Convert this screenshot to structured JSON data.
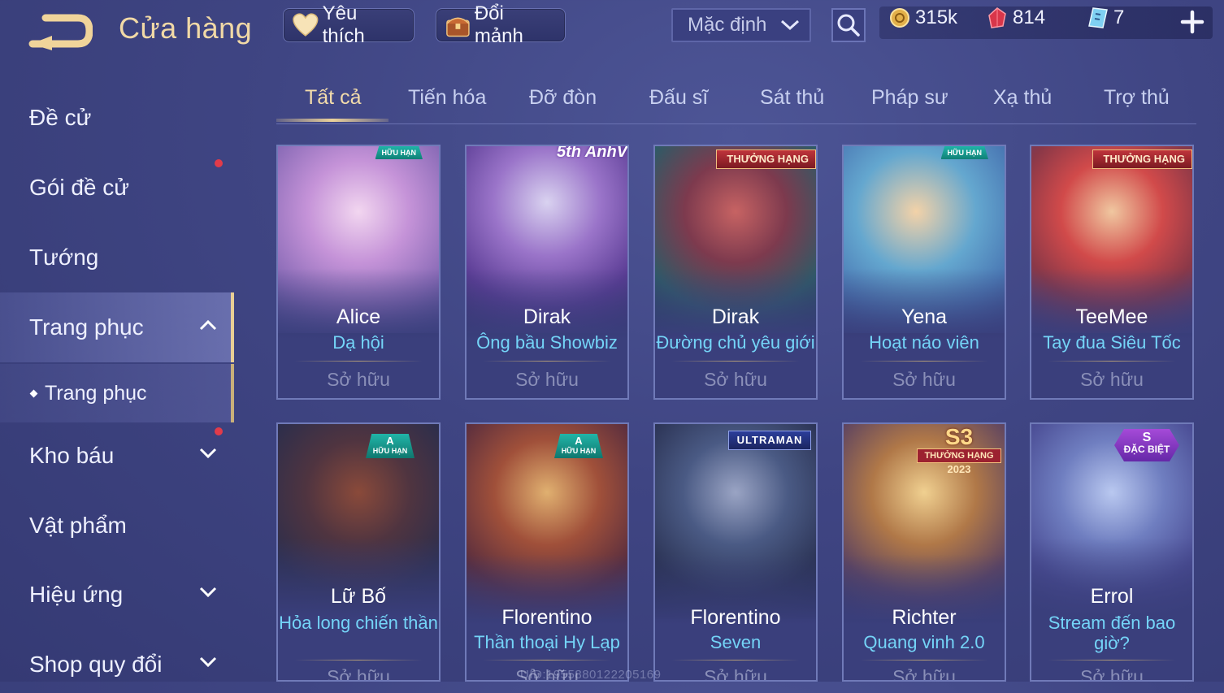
{
  "header": {
    "title": "Cửa hàng",
    "favorites_label": "Yêu thích",
    "exchange_label": "Đổi mảnh",
    "sort_value": "Mặc định"
  },
  "currency": {
    "gold": "315k",
    "ruby": "814",
    "voucher": "7"
  },
  "sidebar": {
    "items": [
      {
        "label": "Đề cử"
      },
      {
        "label": "Gói đề cử"
      },
      {
        "label": "Tướng"
      },
      {
        "label": "Trang phục"
      },
      {
        "label": "Trang phục"
      },
      {
        "label": "Kho báu"
      },
      {
        "label": "Vật phẩm"
      },
      {
        "label": "Hiệu ứng"
      },
      {
        "label": "Shop quy đổi"
      }
    ]
  },
  "tabs": [
    {
      "label": "Tất cả"
    },
    {
      "label": "Tiến hóa"
    },
    {
      "label": "Đỡ đòn"
    },
    {
      "label": "Đấu sĩ"
    },
    {
      "label": "Sát thủ"
    },
    {
      "label": "Pháp sư"
    },
    {
      "label": "Xạ thủ"
    },
    {
      "label": "Trợ thủ"
    }
  ],
  "cards": [
    {
      "hero": "Alice",
      "skin": "Dạ hội",
      "status": "Sở hữu",
      "badge": "HỮU HẠN"
    },
    {
      "hero": "Dirak",
      "skin": "Ông bầu Showbiz",
      "status": "Sở hữu",
      "badge": "",
      "art_text": "5th AnhV"
    },
    {
      "hero": "Dirak",
      "skin": "Đường chủ yêu giới",
      "status": "Sở hữu",
      "badge": "THƯỞNG HẠNG"
    },
    {
      "hero": "Yena",
      "skin": "Hoạt náo viên",
      "status": "Sở hữu",
      "badge": "HỮU HẠN"
    },
    {
      "hero": "TeeMee",
      "skin": "Tay đua Siêu Tốc",
      "status": "Sở hữu",
      "badge": "THƯỞNG HẠNG"
    },
    {
      "hero": "Lữ Bố",
      "skin": "Hỏa long chiến thần",
      "status": "Sở hữu",
      "badge_top": "A",
      "badge": "HỮU HẠN"
    },
    {
      "hero": "Florentino",
      "skin": "Thần thoại Hy Lạp",
      "status": "Sở hữu",
      "badge_top": "A",
      "badge": "HỮU HẠN"
    },
    {
      "hero": "Florentino",
      "skin": "Seven",
      "status": "Sở hữu",
      "badge": "ULTRAMAN"
    },
    {
      "hero": "Richter",
      "skin": "Quang vinh 2.0",
      "status": "Sở hữu",
      "badge_top": "S3",
      "badge": "THƯỞNG HẠNG",
      "badge_year": "2023"
    },
    {
      "hero": "Errol",
      "skin": "Stream đến bao giờ?",
      "status": "Sở hữu",
      "badge_top": "S",
      "badge": "ĐẶC BIỆT"
    }
  ],
  "footer": {
    "user_id": "UID:1955880122205169"
  },
  "colors": {
    "background": "#3f4583",
    "accent_gold": "#f1d9a6",
    "skin_name": "#74d4f7",
    "notification": "#e23b4a"
  }
}
